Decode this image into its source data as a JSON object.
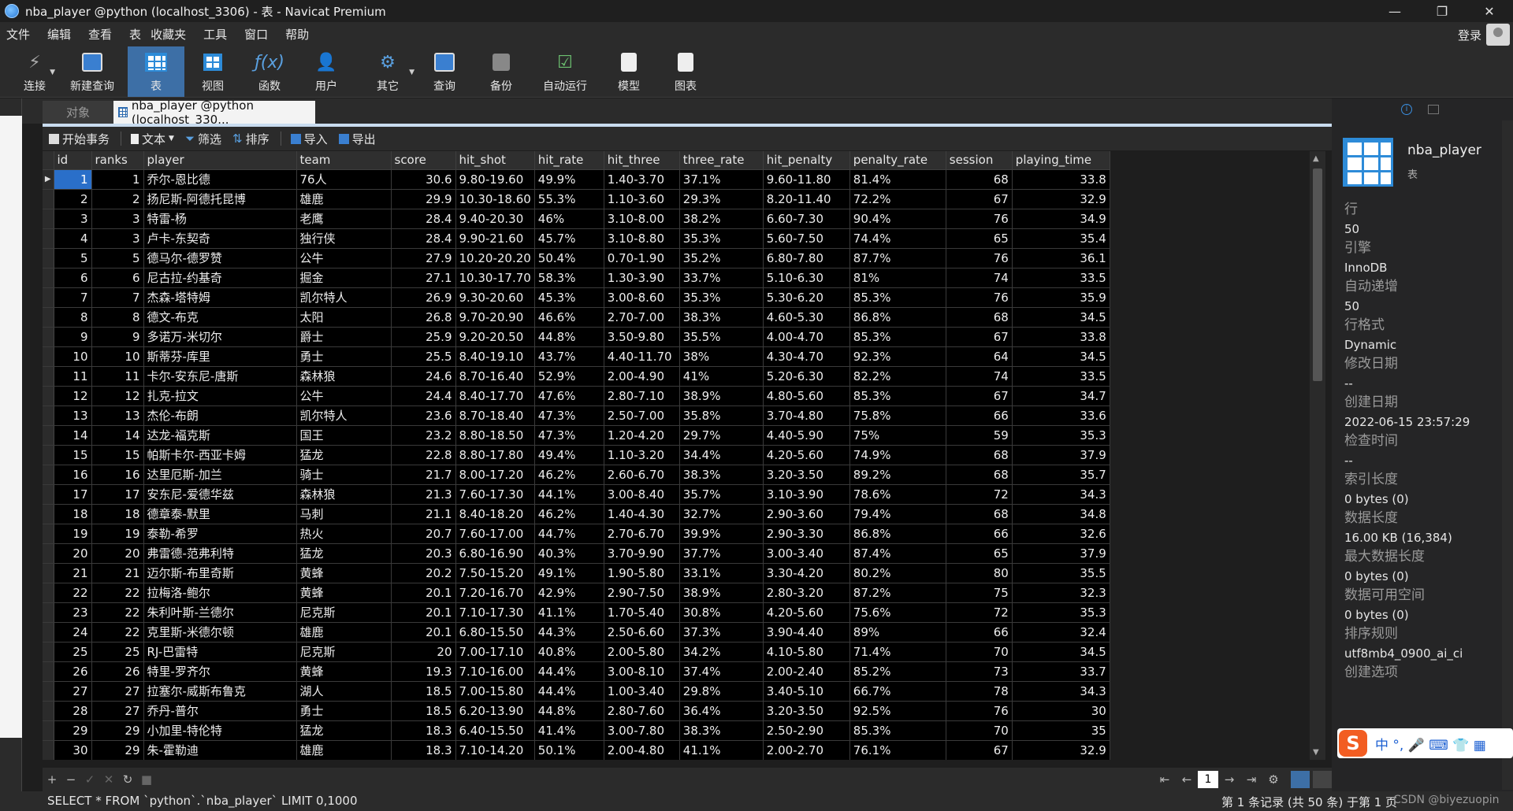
{
  "window": {
    "title": "nba_player @python (localhost_3306) - 表 - Navicat Premium",
    "minimize": "—",
    "restore": "❐",
    "close": "✕"
  },
  "menu": {
    "items": [
      "文件",
      "编辑",
      "查看",
      "表",
      "收藏夹",
      "工具",
      "窗口",
      "帮助"
    ],
    "login": "登录"
  },
  "toolbar": {
    "buttons": [
      {
        "label": "连接",
        "icon": "connection-icon"
      },
      {
        "label": "新建查询",
        "icon": "new-query-icon"
      },
      {
        "label": "表",
        "icon": "table-icon"
      },
      {
        "label": "视图",
        "icon": "view-icon"
      },
      {
        "label": "函数",
        "icon": "function-icon"
      },
      {
        "label": "用户",
        "icon": "user-icon"
      },
      {
        "label": "其它",
        "icon": "other-icon"
      },
      {
        "label": "查询",
        "icon": "query-icon"
      },
      {
        "label": "备份",
        "icon": "backup-icon"
      },
      {
        "label": "自动运行",
        "icon": "automation-icon"
      },
      {
        "label": "模型",
        "icon": "model-icon"
      },
      {
        "label": "图表",
        "icon": "chart-icon"
      }
    ]
  },
  "tabs": {
    "objects": "对象",
    "current": "nba_player @python (localhost_330..."
  },
  "datatools": {
    "begin_transaction": "开始事务",
    "text": "文本",
    "filter": "筛选",
    "sort": "排序",
    "import": "导入",
    "export": "导出"
  },
  "grid": {
    "columns": [
      "id",
      "ranks",
      "player",
      "team",
      "score",
      "hit_shot",
      "hit_rate",
      "hit_three",
      "three_rate",
      "hit_penalty",
      "penalty_rate",
      "session",
      "playing_time"
    ],
    "rows": [
      [
        "1",
        "1",
        "乔尔-恩比德",
        "76人",
        "30.6",
        "9.80-19.60",
        "49.9%",
        "1.40-3.70",
        "37.1%",
        "9.60-11.80",
        "81.4%",
        "68",
        "33.8"
      ],
      [
        "2",
        "2",
        "扬尼斯-阿德托昆博",
        "雄鹿",
        "29.9",
        "10.30-18.60",
        "55.3%",
        "1.10-3.60",
        "29.3%",
        "8.20-11.40",
        "72.2%",
        "67",
        "32.9"
      ],
      [
        "3",
        "3",
        "特雷-杨",
        "老鹰",
        "28.4",
        "9.40-20.30",
        "46%",
        "3.10-8.00",
        "38.2%",
        "6.60-7.30",
        "90.4%",
        "76",
        "34.9"
      ],
      [
        "4",
        "3",
        "卢卡-东契奇",
        "独行侠",
        "28.4",
        "9.90-21.60",
        "45.7%",
        "3.10-8.80",
        "35.3%",
        "5.60-7.50",
        "74.4%",
        "65",
        "35.4"
      ],
      [
        "5",
        "5",
        "德马尔-德罗赞",
        "公牛",
        "27.9",
        "10.20-20.20",
        "50.4%",
        "0.70-1.90",
        "35.2%",
        "6.80-7.80",
        "87.7%",
        "76",
        "36.1"
      ],
      [
        "6",
        "6",
        "尼古拉-约基奇",
        "掘金",
        "27.1",
        "10.30-17.70",
        "58.3%",
        "1.30-3.90",
        "33.7%",
        "5.10-6.30",
        "81%",
        "74",
        "33.5"
      ],
      [
        "7",
        "7",
        "杰森-塔特姆",
        "凯尔特人",
        "26.9",
        "9.30-20.60",
        "45.3%",
        "3.00-8.60",
        "35.3%",
        "5.30-6.20",
        "85.3%",
        "76",
        "35.9"
      ],
      [
        "8",
        "8",
        "德文-布克",
        "太阳",
        "26.8",
        "9.70-20.90",
        "46.6%",
        "2.70-7.00",
        "38.3%",
        "4.60-5.30",
        "86.8%",
        "68",
        "34.5"
      ],
      [
        "9",
        "9",
        "多诺万-米切尔",
        "爵士",
        "25.9",
        "9.20-20.50",
        "44.8%",
        "3.50-9.80",
        "35.5%",
        "4.00-4.70",
        "85.3%",
        "67",
        "33.8"
      ],
      [
        "10",
        "10",
        "斯蒂芬-库里",
        "勇士",
        "25.5",
        "8.40-19.10",
        "43.7%",
        "4.40-11.70",
        "38%",
        "4.30-4.70",
        "92.3%",
        "64",
        "34.5"
      ],
      [
        "11",
        "11",
        "卡尔-安东尼-唐斯",
        "森林狼",
        "24.6",
        "8.70-16.40",
        "52.9%",
        "2.00-4.90",
        "41%",
        "5.20-6.30",
        "82.2%",
        "74",
        "33.5"
      ],
      [
        "12",
        "12",
        "扎克-拉文",
        "公牛",
        "24.4",
        "8.40-17.70",
        "47.6%",
        "2.80-7.10",
        "38.9%",
        "4.80-5.60",
        "85.3%",
        "67",
        "34.7"
      ],
      [
        "13",
        "13",
        "杰伦-布朗",
        "凯尔特人",
        "23.6",
        "8.70-18.40",
        "47.3%",
        "2.50-7.00",
        "35.8%",
        "3.70-4.80",
        "75.8%",
        "66",
        "33.6"
      ],
      [
        "14",
        "14",
        "达龙-福克斯",
        "国王",
        "23.2",
        "8.80-18.50",
        "47.3%",
        "1.20-4.20",
        "29.7%",
        "4.40-5.90",
        "75%",
        "59",
        "35.3"
      ],
      [
        "15",
        "15",
        "帕斯卡尔-西亚卡姆",
        "猛龙",
        "22.8",
        "8.80-17.80",
        "49.4%",
        "1.10-3.20",
        "34.4%",
        "4.20-5.60",
        "74.9%",
        "68",
        "37.9"
      ],
      [
        "16",
        "16",
        "达里厄斯-加兰",
        "骑士",
        "21.7",
        "8.00-17.20",
        "46.2%",
        "2.60-6.70",
        "38.3%",
        "3.20-3.50",
        "89.2%",
        "68",
        "35.7"
      ],
      [
        "17",
        "17",
        "安东尼-爱德华兹",
        "森林狼",
        "21.3",
        "7.60-17.30",
        "44.1%",
        "3.00-8.40",
        "35.7%",
        "3.10-3.90",
        "78.6%",
        "72",
        "34.3"
      ],
      [
        "18",
        "18",
        "德章泰-默里",
        "马刺",
        "21.1",
        "8.40-18.20",
        "46.2%",
        "1.40-4.30",
        "32.7%",
        "2.90-3.60",
        "79.4%",
        "68",
        "34.8"
      ],
      [
        "19",
        "19",
        "泰勒-希罗",
        "热火",
        "20.7",
        "7.60-17.00",
        "44.7%",
        "2.70-6.70",
        "39.9%",
        "2.90-3.30",
        "86.8%",
        "66",
        "32.6"
      ],
      [
        "20",
        "20",
        "弗雷德-范弗利特",
        "猛龙",
        "20.3",
        "6.80-16.90",
        "40.3%",
        "3.70-9.90",
        "37.7%",
        "3.00-3.40",
        "87.4%",
        "65",
        "37.9"
      ],
      [
        "21",
        "21",
        "迈尔斯-布里奇斯",
        "黄蜂",
        "20.2",
        "7.50-15.20",
        "49.1%",
        "1.90-5.80",
        "33.1%",
        "3.30-4.20",
        "80.2%",
        "80",
        "35.5"
      ],
      [
        "22",
        "22",
        "拉梅洛-鲍尔",
        "黄蜂",
        "20.1",
        "7.20-16.70",
        "42.9%",
        "2.90-7.50",
        "38.9%",
        "2.80-3.20",
        "87.2%",
        "75",
        "32.3"
      ],
      [
        "23",
        "22",
        "朱利叶斯-兰德尔",
        "尼克斯",
        "20.1",
        "7.10-17.30",
        "41.1%",
        "1.70-5.40",
        "30.8%",
        "4.20-5.60",
        "75.6%",
        "72",
        "35.3"
      ],
      [
        "24",
        "22",
        "克里斯-米德尔顿",
        "雄鹿",
        "20.1",
        "6.80-15.50",
        "44.3%",
        "2.50-6.60",
        "37.3%",
        "3.90-4.40",
        "89%",
        "66",
        "32.4"
      ],
      [
        "25",
        "25",
        "RJ-巴雷特",
        "尼克斯",
        "20",
        "7.00-17.10",
        "40.8%",
        "2.00-5.80",
        "34.2%",
        "4.10-5.80",
        "71.4%",
        "70",
        "34.5"
      ],
      [
        "26",
        "26",
        "特里-罗齐尔",
        "黄蜂",
        "19.3",
        "7.10-16.00",
        "44.4%",
        "3.00-8.10",
        "37.4%",
        "2.00-2.40",
        "85.2%",
        "73",
        "33.7"
      ],
      [
        "27",
        "27",
        "拉塞尔-威斯布鲁克",
        "湖人",
        "18.5",
        "7.00-15.80",
        "44.4%",
        "1.00-3.40",
        "29.8%",
        "3.40-5.10",
        "66.7%",
        "78",
        "34.3"
      ],
      [
        "28",
        "27",
        "乔丹-普尔",
        "勇士",
        "18.5",
        "6.20-13.90",
        "44.8%",
        "2.80-7.60",
        "36.4%",
        "3.20-3.50",
        "92.5%",
        "76",
        "30"
      ],
      [
        "29",
        "29",
        "小加里-特伦特",
        "猛龙",
        "18.3",
        "6.40-15.50",
        "41.4%",
        "3.00-7.80",
        "38.3%",
        "2.50-2.90",
        "85.3%",
        "70",
        "35"
      ],
      [
        "30",
        "29",
        "朱-霍勒迪",
        "雄鹿",
        "18.3",
        "7.10-14.20",
        "50.1%",
        "2.00-4.80",
        "41.1%",
        "2.00-2.70",
        "76.1%",
        "67",
        "32.9"
      ]
    ],
    "selected_row_marker": "▶"
  },
  "nav": {
    "add": "+",
    "remove": "−",
    "apply": "✓",
    "discard": "✕",
    "refresh": "↻",
    "stop": "■",
    "first": "⇤",
    "prev": "←",
    "page": "1",
    "next": "→",
    "last": "⇥",
    "settings": "⚙"
  },
  "status": {
    "sql": "SELECT * FROM `python`.`nba_player` LIMIT 0,1000",
    "records": "第 1 条记录 (共 50 条) 于第 1 页",
    "watermark": "CSDN @biyezuopin"
  },
  "info_panel": {
    "name": "nba_player",
    "type": "表",
    "fields": [
      {
        "label": "行",
        "value": "50"
      },
      {
        "label": "引擎",
        "value": "InnoDB"
      },
      {
        "label": "自动递增",
        "value": "50"
      },
      {
        "label": "行格式",
        "value": "Dynamic"
      },
      {
        "label": "修改日期",
        "value": "--"
      },
      {
        "label": "创建日期",
        "value": "2022-06-15 23:57:29"
      },
      {
        "label": "检查时间",
        "value": "--"
      },
      {
        "label": "索引长度",
        "value": "0 bytes (0)"
      },
      {
        "label": "数据长度",
        "value": "16.00 KB (16,384)"
      },
      {
        "label": "最大数据长度",
        "value": "0 bytes (0)"
      },
      {
        "label": "数据可用空间",
        "value": "0 bytes (0)"
      },
      {
        "label": "排序规则",
        "value": "utf8mb4_0900_ai_ci"
      },
      {
        "label": "创建选项",
        "value": ""
      }
    ]
  },
  "ime": {
    "logo": "S",
    "glyphs": "中 °, 🎤 ⌨ 👕 ▦"
  },
  "colors": {
    "accent": "#3d6fa6",
    "selection": "#2a6fc9",
    "grid_bg": "#000000"
  }
}
